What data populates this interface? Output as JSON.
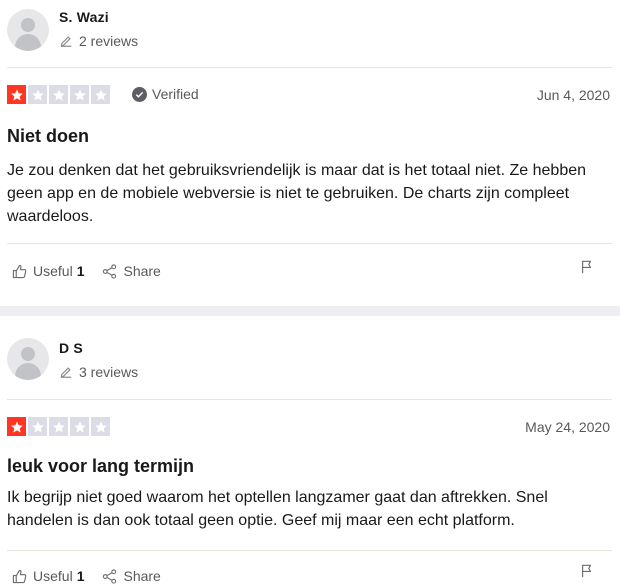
{
  "reviews": [
    {
      "author": "S. Wazi",
      "review_count": "2 reviews",
      "rating": 1,
      "rating_max": 5,
      "verified_label": "Verified",
      "date": "Jun 4, 2020",
      "title": "Niet doen",
      "body": "Je zou denken dat het gebruiksvriendelijk is maar dat is het totaal niet. Ze hebben geen app en de mobiele webversie is niet te gebruiken. De charts zijn compleet waardeloos.",
      "useful_label": "Useful",
      "useful_count": "1",
      "share_label": "Share"
    },
    {
      "author": "D S",
      "review_count": "3 reviews",
      "rating": 1,
      "rating_max": 5,
      "date": "May 24, 2020",
      "title": "leuk voor lang termijn",
      "body": "Ik begrijp niet goed waarom het optellen langzamer gaat dan aftrekken. Snel handelen is dan ook totaal geen optie. Geef mij maar een echt platform.",
      "useful_label": "Useful",
      "useful_count": "1",
      "share_label": "Share"
    }
  ],
  "colors": {
    "star_on": "#ff3722",
    "star_off": "#dcdce6",
    "separator": "#eeeef2"
  },
  "icons": [
    "avatar-icon",
    "pencil-icon",
    "star-icon",
    "verified-check-icon",
    "thumbs-up-icon",
    "share-icon",
    "flag-icon"
  ]
}
